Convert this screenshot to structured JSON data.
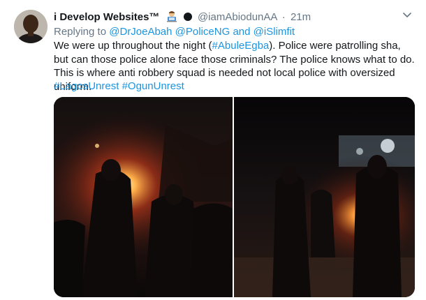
{
  "tweet": {
    "display_name": "i Develop Websites™",
    "handle": "@iamAbiodunAA",
    "separator": "·",
    "time": "21m",
    "reply_prefix": "Replying to",
    "reply_user_1": "@DrJoeAbah",
    "reply_user_2": "@PoliceNG",
    "reply_and": "and",
    "reply_user_3": "@iSlimfit",
    "text_part1": "We were up throughout the night (",
    "text_hashtag_inline": "#AbuleEgba",
    "text_part2": "). Police were patrolling  sha, but can those police alone face those criminals? The police knows what to do. This is where anti robbery squad is needed not local police with oversized uniform.",
    "hashtag_1": "#LagosUnrest",
    "hashtag_2": "#OgunUnrest"
  },
  "icons": {
    "verified_emoji": "man-technologist-emoji-icon",
    "status": "black-circle-icon",
    "menu": "chevron-down-icon"
  },
  "colors": {
    "link": "#1b95e0",
    "muted": "#657786",
    "text": "#14171a"
  }
}
